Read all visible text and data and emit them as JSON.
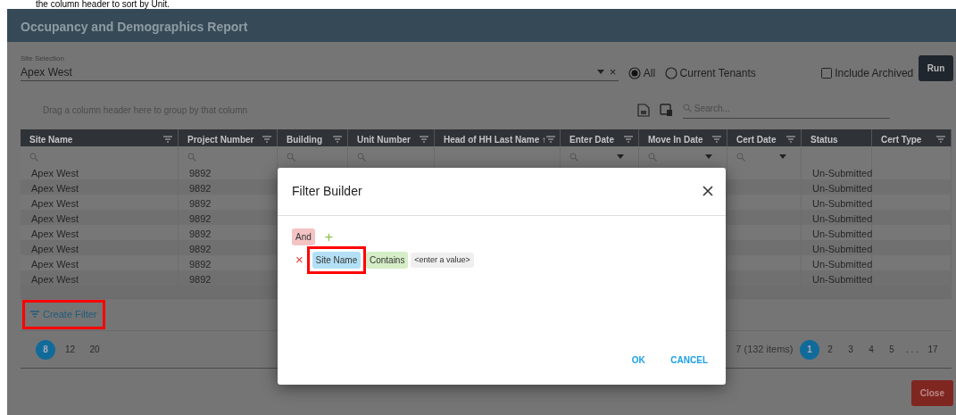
{
  "caption": "the column header to sort by Unit.",
  "window": {
    "title": "Occupancy and Demographics Report"
  },
  "site_selection": {
    "label": "Site Selection",
    "value": "Apex West",
    "clear": "×"
  },
  "tenant_filter": [
    {
      "label": "All",
      "selected": true
    },
    {
      "label": "Current Tenants",
      "selected": false
    }
  ],
  "include_archived": {
    "label": "Include Archived",
    "checked": false
  },
  "run_button": "Run",
  "group_panel": "Drag a column header here to group by that column",
  "search": {
    "placeholder": "Search..."
  },
  "table": {
    "columns": [
      {
        "label": "Site Name",
        "kind": "text"
      },
      {
        "label": "Project Number",
        "kind": "text"
      },
      {
        "label": "Building",
        "kind": "text"
      },
      {
        "label": "Unit Number",
        "kind": "text"
      },
      {
        "label": "Head of HH Last Name",
        "sort_mark": "↑",
        "kind": "none"
      },
      {
        "label": "Enter Date",
        "kind": "date"
      },
      {
        "label": "Move In Date",
        "kind": "date"
      },
      {
        "label": "Cert Date",
        "kind": "date"
      },
      {
        "label": "Status",
        "kind": "plain"
      },
      {
        "label": "Cert Type",
        "kind": "none"
      }
    ],
    "rows": [
      {
        "site_name": "Apex West",
        "project_number": "9892",
        "status": "Un-Submitted"
      },
      {
        "site_name": "Apex West",
        "project_number": "9892",
        "status": "Un-Submitted"
      },
      {
        "site_name": "Apex West",
        "project_number": "9892",
        "status": "Un-Submitted"
      },
      {
        "site_name": "Apex West",
        "project_number": "9892",
        "status": "Un-Submitted"
      },
      {
        "site_name": "Apex West",
        "project_number": "9892",
        "status": "Un-Submitted"
      },
      {
        "site_name": "Apex West",
        "project_number": "9892",
        "status": "Un-Submitted"
      },
      {
        "site_name": "Apex West",
        "project_number": "9892",
        "status": "Un-Submitted"
      },
      {
        "site_name": "Apex West",
        "project_number": "9892",
        "status": "Un-Submitted"
      }
    ]
  },
  "create_filter": {
    "label": "Create Filter",
    "highlighted": true
  },
  "page_sizes": [
    {
      "label": "8",
      "selected": true
    },
    {
      "label": "12",
      "selected": false
    },
    {
      "label": "20",
      "selected": false
    }
  ],
  "page_info": "7 (132 items)",
  "pages": [
    {
      "label": "1",
      "selected": true
    },
    {
      "label": "2",
      "selected": false
    },
    {
      "label": "3",
      "selected": false
    },
    {
      "label": "4",
      "selected": false
    },
    {
      "label": "5",
      "selected": false
    },
    {
      "label": ". . .",
      "selected": false
    },
    {
      "label": "17",
      "selected": false
    }
  ],
  "close_button": "Close",
  "filter_builder": {
    "title": "Filter Builder",
    "group_operator": "And",
    "add": "+",
    "condition": {
      "remove": "×",
      "field": "Site Name",
      "operation": "Contains",
      "value_placeholder": "<enter a value>",
      "highlighted": true
    },
    "buttons": [
      "OK",
      "CANCEL"
    ]
  }
}
